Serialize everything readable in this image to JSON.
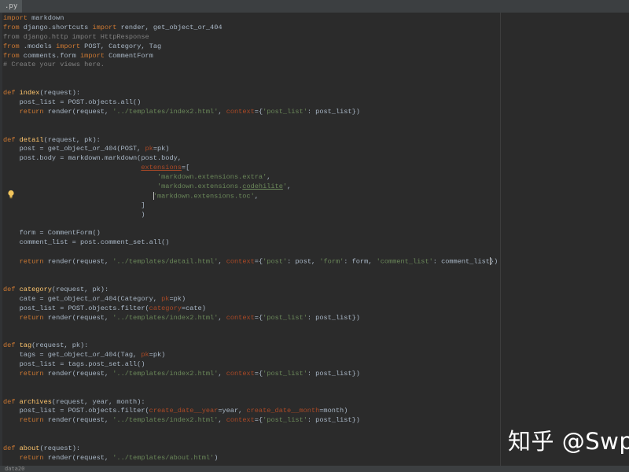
{
  "tab": {
    "label": ".py"
  },
  "status": {
    "text": "data20"
  },
  "watermark": "知乎 @Swpa",
  "code_lines": [
    [
      [
        "kw",
        "import"
      ],
      [
        "p",
        " markdown"
      ]
    ],
    [
      [
        "kw",
        "from"
      ],
      [
        "p",
        " django.shortcuts "
      ],
      [
        "kw",
        "import"
      ],
      [
        "p",
        " render, get_object_or_404"
      ]
    ],
    [
      [
        "cm",
        "from django.http import HttpResponse"
      ]
    ],
    [
      [
        "kw",
        "from"
      ],
      [
        "p",
        " .models "
      ],
      [
        "kw",
        "import"
      ],
      [
        "p",
        " POST, Category, Tag"
      ]
    ],
    [
      [
        "kw",
        "from"
      ],
      [
        "p",
        " comments.form "
      ],
      [
        "kw",
        "import"
      ],
      [
        "p",
        " CommentForm"
      ]
    ],
    [
      [
        "cm",
        "# Create your views here."
      ]
    ],
    [],
    [],
    [
      [
        "kw",
        "def"
      ],
      [
        "def",
        " index"
      ],
      [
        "p",
        "(request):"
      ]
    ],
    [
      [
        "p",
        "    post_list = POST.objects.all()"
      ]
    ],
    [
      [
        "p",
        "    "
      ],
      [
        "kw",
        "return"
      ],
      [
        "p",
        " render(request, "
      ],
      [
        "str",
        "'../templates/index2.html'"
      ],
      [
        "p",
        ", "
      ],
      [
        "param",
        "context"
      ],
      [
        "p",
        "={"
      ],
      [
        "str",
        "'post_list'"
      ],
      [
        "p",
        ": post_list})"
      ]
    ],
    [],
    [],
    [
      [
        "kw",
        "def"
      ],
      [
        "def",
        " detail"
      ],
      [
        "p",
        "(request, pk):"
      ]
    ],
    [
      [
        "p",
        "    post = get_object_or_404(POST, "
      ],
      [
        "param",
        "pk"
      ],
      [
        "p",
        "=pk)"
      ]
    ],
    [
      [
        "p",
        "    post.body = markdown.markdown(post.body,"
      ]
    ],
    [
      [
        "p",
        "                                  "
      ],
      [
        "param-u",
        "extensions"
      ],
      [
        "p",
        "=["
      ]
    ],
    [
      [
        "p",
        "                                      "
      ],
      [
        "str",
        "'markdown.extensions.extra'"
      ],
      [
        "p",
        ","
      ]
    ],
    [
      [
        "p",
        "                                      "
      ],
      [
        "str",
        "'markdown.extensions."
      ],
      [
        "str-u",
        "codehilite"
      ],
      [
        "str",
        "'"
      ],
      [
        "p",
        ","
      ]
    ],
    [
      [
        "p",
        "                                     "
      ],
      [
        "cur",
        ""
      ],
      [
        "str",
        "'markdown.extensions.toc'"
      ],
      [
        "p",
        ","
      ]
    ],
    [
      [
        "p",
        "                                  ]"
      ]
    ],
    [
      [
        "p",
        "                                  )"
      ]
    ],
    [],
    [
      [
        "p",
        "    form = CommentForm()"
      ]
    ],
    [
      [
        "p",
        "    comment_list = post.comment_set.all()"
      ]
    ],
    [],
    [
      [
        "p",
        "    "
      ],
      [
        "kw",
        "return"
      ],
      [
        "p",
        " render(request, "
      ],
      [
        "str",
        "'../templates/detail.html'"
      ],
      [
        "p",
        ", "
      ],
      [
        "param",
        "context"
      ],
      [
        "p",
        "={"
      ],
      [
        "str",
        "'post'"
      ],
      [
        "p",
        ": post, "
      ],
      [
        "str",
        "'form'"
      ],
      [
        "p",
        ": form, "
      ],
      [
        "str",
        "'comment_list'"
      ],
      [
        "p",
        ": comment_list"
      ],
      [
        "cur",
        ""
      ],
      [
        "p",
        "})"
      ]
    ],
    [],
    [],
    [
      [
        "kw",
        "def"
      ],
      [
        "def",
        " category"
      ],
      [
        "p",
        "(request, pk):"
      ]
    ],
    [
      [
        "p",
        "    cate = get_object_or_404(Category, "
      ],
      [
        "param",
        "pk"
      ],
      [
        "p",
        "=pk)"
      ]
    ],
    [
      [
        "p",
        "    post_list = POST.objects.filter("
      ],
      [
        "param",
        "category"
      ],
      [
        "p",
        "=cate)"
      ]
    ],
    [
      [
        "p",
        "    "
      ],
      [
        "kw",
        "return"
      ],
      [
        "p",
        " render(request, "
      ],
      [
        "str",
        "'../templates/index2.html'"
      ],
      [
        "p",
        ", "
      ],
      [
        "param",
        "context"
      ],
      [
        "p",
        "={"
      ],
      [
        "str",
        "'post_list'"
      ],
      [
        "p",
        ": post_list})"
      ]
    ],
    [],
    [],
    [
      [
        "kw",
        "def"
      ],
      [
        "def",
        " tag"
      ],
      [
        "p",
        "(request, pk):"
      ]
    ],
    [
      [
        "p",
        "    tags = get_object_or_404(Tag, "
      ],
      [
        "param",
        "pk"
      ],
      [
        "p",
        "=pk)"
      ]
    ],
    [
      [
        "p",
        "    post_list = tags.post_set.all()"
      ]
    ],
    [
      [
        "p",
        "    "
      ],
      [
        "kw",
        "return"
      ],
      [
        "p",
        " render(request, "
      ],
      [
        "str",
        "'../templates/index2.html'"
      ],
      [
        "p",
        ", "
      ],
      [
        "param",
        "context"
      ],
      [
        "p",
        "={"
      ],
      [
        "str",
        "'post_list'"
      ],
      [
        "p",
        ": post_list})"
      ]
    ],
    [],
    [],
    [
      [
        "kw",
        "def"
      ],
      [
        "def",
        " archives"
      ],
      [
        "p",
        "(request, year, month):"
      ]
    ],
    [
      [
        "p",
        "    post_list = POST.objects.filter("
      ],
      [
        "param",
        "create_date__year"
      ],
      [
        "p",
        "=year, "
      ],
      [
        "param",
        "create_date__month"
      ],
      [
        "p",
        "=month)"
      ]
    ],
    [
      [
        "p",
        "    "
      ],
      [
        "kw",
        "return"
      ],
      [
        "p",
        " render(request, "
      ],
      [
        "str",
        "'../templates/index2.html'"
      ],
      [
        "p",
        ", "
      ],
      [
        "param",
        "context"
      ],
      [
        "p",
        "={"
      ],
      [
        "str",
        "'post_list'"
      ],
      [
        "p",
        ": post_list})"
      ]
    ],
    [],
    [],
    [
      [
        "kw",
        "def"
      ],
      [
        "def",
        " about"
      ],
      [
        "p",
        "(request):"
      ]
    ],
    [
      [
        "p",
        "    "
      ],
      [
        "kw",
        "return"
      ],
      [
        "p",
        " render(request, "
      ],
      [
        "str",
        "'../templates/about.html'"
      ],
      [
        "p",
        ")"
      ]
    ]
  ]
}
